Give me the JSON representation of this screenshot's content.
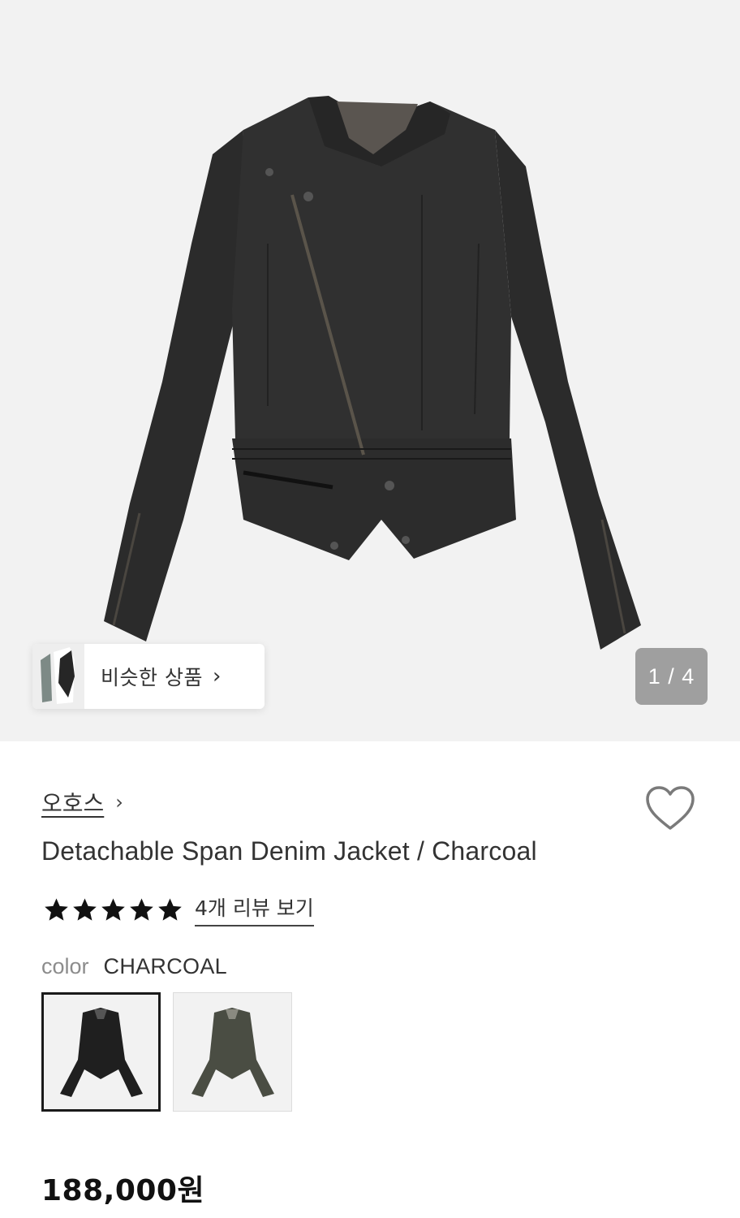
{
  "gallery": {
    "similar_label": "비슷한 상품",
    "similar_chevron": "›",
    "pager": "1 / 4"
  },
  "product": {
    "brand": "오호스",
    "brand_chevron": "›",
    "title": "Detachable Span Denim Jacket / Charcoal",
    "rating_stars": 5,
    "review_link": "4개 리뷰 보기",
    "color_label": "color",
    "color_value": "CHARCOAL",
    "swatches": [
      {
        "name": "charcoal",
        "selected": true,
        "color": "#1f1f1f"
      },
      {
        "name": "khaki",
        "selected": false,
        "color": "#4a4d43"
      }
    ],
    "price": "188,000원"
  }
}
